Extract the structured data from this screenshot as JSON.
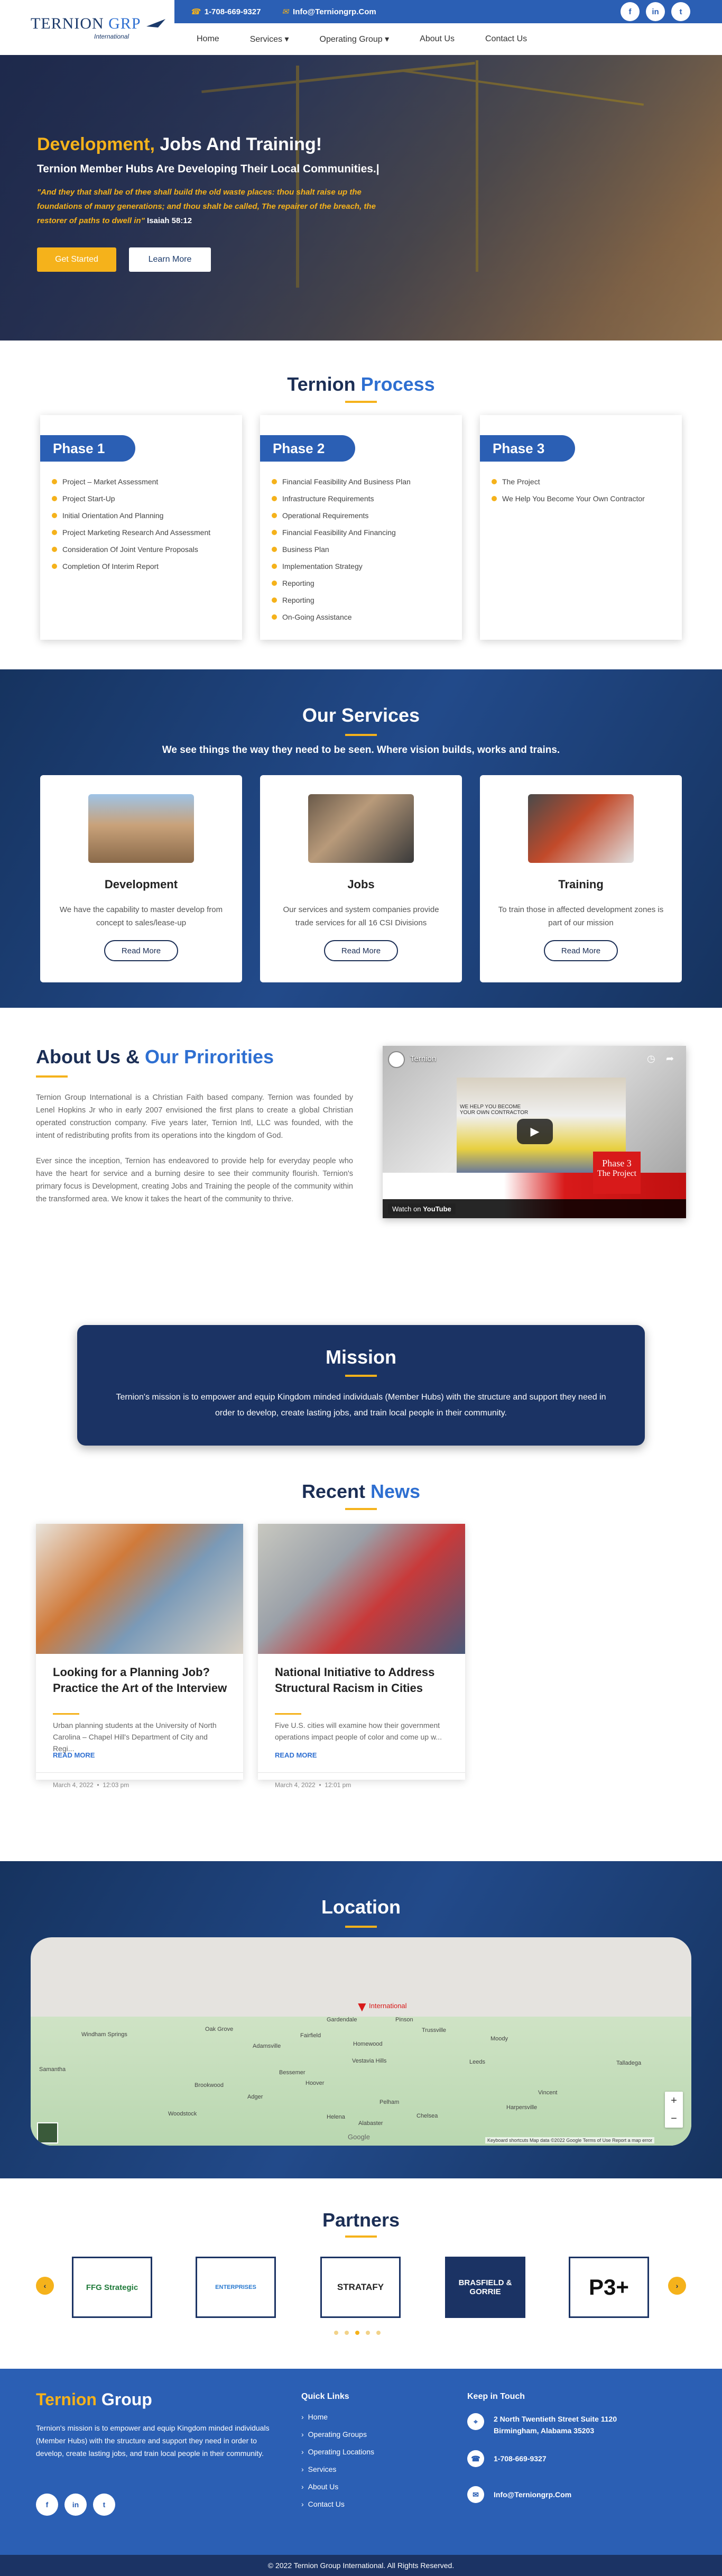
{
  "brand": {
    "logo_main": "TERNION",
    "logo_accent": "GRP",
    "logo_sub": "International"
  },
  "contact_bar": {
    "phone": "1-708-669-9327",
    "email": "Info@Terniongrp.Com"
  },
  "socials": [
    "f",
    "in",
    "t"
  ],
  "nav": {
    "items": [
      "Home",
      "Services ▾",
      "Operating Group ▾",
      "About Us",
      "Contact Us"
    ]
  },
  "hero": {
    "title_accent": "Development,",
    "title_rest": " Jobs And Training!",
    "subtitle": "Ternion Member Hubs Are Developing Their Local Communities.|",
    "quote": "\"And they that shall be of thee shall build the old waste places: thou shalt raise up the foundations of many generations; and thou shalt be called, The repairer of the breach, the restorer of paths to dwell in\"",
    "quote_ref": "Isaiah 58:12",
    "btn_primary": "Get Started",
    "btn_secondary": "Learn More"
  },
  "process": {
    "title_a": "Ternion",
    "title_b": "Process",
    "phases": [
      {
        "label": "Phase 1",
        "items": [
          "Project – Market Assessment",
          "Project Start-Up",
          "Initial Orientation And Planning",
          "Project Marketing Research And Assessment",
          "Consideration Of Joint Venture Proposals",
          "Completion Of Interim Report"
        ]
      },
      {
        "label": "Phase 2",
        "items": [
          "Financial Feasibility And Business Plan",
          "Infrastructure Requirements",
          "Operational Requirements",
          "Financial Feasibility And Financing",
          "Business Plan",
          "Implementation Strategy",
          "Reporting",
          "Reporting",
          "On-Going Assistance"
        ]
      },
      {
        "label": "Phase 3",
        "items": [
          "The Project",
          "We Help You Become Your Own Contractor"
        ]
      }
    ]
  },
  "services": {
    "title": "Our Services",
    "subtitle": "We see things the way they need to be seen. Where vision builds, works and trains.",
    "cards": [
      {
        "title": "Development",
        "text": "We have the capability to master develop from concept to sales/lease-up",
        "button": "Read More"
      },
      {
        "title": "Jobs",
        "text": "Our services and system companies provide trade services for all 16 CSI Divisions",
        "button": "Read More"
      },
      {
        "title": "Training",
        "text": "To train those in affected development zones is part of our mission",
        "button": "Read More"
      }
    ]
  },
  "about": {
    "title_a": "About Us &",
    "title_b": "Our Prirorities",
    "p1": "Ternion Group International is a Christian Faith based company. Ternion was founded by Lenel Hopkins Jr who in early 2007 envisioned the first plans to create a global Christian operated construction company. Five years later, Ternion Intl, LLC was founded, with the intent of redistributing profits from its operations into the kingdom of God.",
    "p2": "Ever since the inception, Ternion has endeavored to provide help for everyday people who have the heart for service and a burning desire to see their community flourish. Ternion's primary focus is Development, creating Jobs and Training the people of the community within the transformed area. We know it takes the heart of the community to thrive.",
    "video": {
      "channel": "Ternion",
      "phase_label": "Phase 3",
      "phase_sub": "The Project",
      "watch": "Watch on",
      "yt": "YouTube",
      "caption": "WE HELP YOU BECOME YOUR OWN CONTRACTOR"
    }
  },
  "mission": {
    "title": "Mission",
    "text": "Ternion's mission is to empower and equip Kingdom minded individuals (Member Hubs) with the structure and support they need in order to develop, create lasting jobs, and train local people in their community."
  },
  "news": {
    "title_a": "Recent",
    "title_b": "News",
    "items": [
      {
        "title": "Looking for a Planning Job? Practice the Art of the Interview",
        "excerpt": "Urban planning students at the University of North Carolina – Chapel Hill's Department of City and Regi...",
        "more": "READ MORE",
        "date": "March 4, 2022",
        "time": "12:03 pm"
      },
      {
        "title": "National Initiative to Address Structural Racism in Cities",
        "excerpt": "Five U.S. cities will examine how their government operations impact people of color and come up w...",
        "more": "READ MORE",
        "date": "March 4, 2022",
        "time": "12:01 pm"
      }
    ]
  },
  "location": {
    "title": "Location",
    "pin_label": "International",
    "places": [
      "Fairfield",
      "Homewood",
      "Vestavia Hills",
      "Hoover",
      "Bessemer",
      "Pelham",
      "Alabaster",
      "Chelsea",
      "Leeds",
      "Moody",
      "Trussville",
      "Gardendale",
      "Pinson",
      "Adamsville",
      "Oak Grove",
      "Vincent",
      "Talladega",
      "Harpersville",
      "Woodstock",
      "Samantha",
      "Windham Springs",
      "Adger",
      "Brookwood",
      "Helena"
    ],
    "footer": "Keyboard shortcuts   Map data ©2022 Google   Terms of Use   Report a map error",
    "zoom_in": "+",
    "zoom_out": "−",
    "google": "Google"
  },
  "partners": {
    "title": "Partners",
    "logos": [
      "FFG Strategic",
      "ENTERPRISES",
      "STRATAFY",
      "BRASFIELD & GORRIE",
      "P3+"
    ],
    "prev": "‹",
    "next": "›"
  },
  "footer": {
    "title_a": "Ternion",
    "title_b": "Group",
    "text": "Ternion's mission is to empower and equip Kingdom minded individuals (Member Hubs) with the structure and support they need in order to develop, create lasting jobs, and train local people in their community.",
    "quick_title": "Quick Links",
    "quick_links": [
      "Home",
      "Operating Groups",
      "Operating Locations",
      "Services",
      "About Us",
      "Contact Us"
    ],
    "touch_title": "Keep in Touch",
    "address": "2 North Twentieth Street Suite 1120 Birmingham, Alabama 35203",
    "phone": "1-708-669-9327",
    "email": "Info@Terniongrp.Com",
    "copyright": "© 2022 Ternion Group International. All Rights Reserved."
  },
  "colors": {
    "accent": "#f5b21b",
    "primary": "#2b5fb4",
    "navy": "#1b2e55"
  }
}
